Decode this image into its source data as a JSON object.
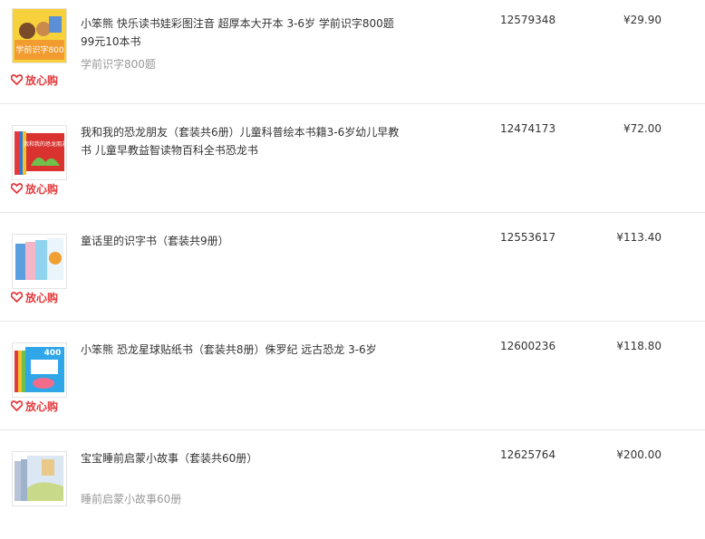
{
  "items": [
    {
      "title": "小笨熊 快乐读书娃彩图注音 超厚本大开本 3-6岁 学前识字800题99元10本书",
      "subtitle": "学前识字800题",
      "sku": "12579348",
      "price": "¥29.90",
      "badge": "放心购",
      "cover_text": "学前识字800"
    },
    {
      "title": "我和我的恐龙朋友（套装共6册）儿童科普绘本书籍3-6岁幼儿早教书 儿童早教益智读物百科全书恐龙书",
      "subtitle": "",
      "sku": "12474173",
      "price": "¥72.00",
      "badge": "放心购",
      "cover_text": "我和我的恐龙朋友"
    },
    {
      "title": "童话里的识字书（套装共9册）",
      "subtitle": "",
      "sku": "12553617",
      "price": "¥113.40",
      "badge": "放心购",
      "cover_text": ""
    },
    {
      "title": "小笨熊 恐龙星球贴纸书（套装共8册）侏罗纪 远古恐龙 3-6岁",
      "subtitle": "",
      "sku": "12600236",
      "price": "¥118.80",
      "badge": "放心购",
      "cover_text": "400"
    },
    {
      "title": "宝宝睡前启蒙小故事（套装共60册）",
      "subtitle": "睡前启蒙小故事60册",
      "sku": "12625764",
      "price": "¥200.00",
      "badge": "",
      "cover_text": ""
    }
  ],
  "colors": {
    "badge_red": "#e4393c",
    "text": "#333333",
    "muted": "#999999",
    "divider": "#e6e6e6"
  },
  "icons": [
    "heart-icon"
  ]
}
